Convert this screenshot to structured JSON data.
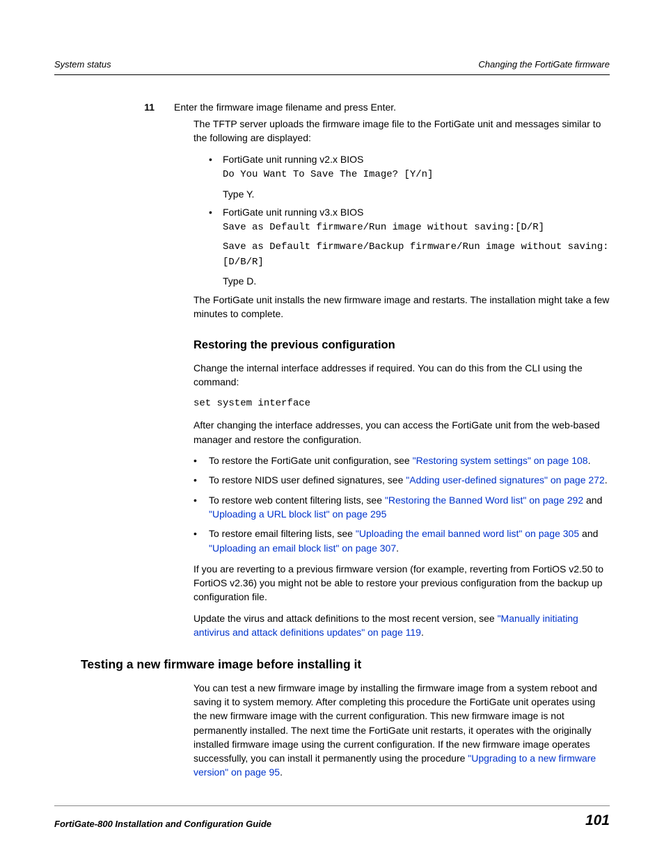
{
  "header": {
    "left": "System status",
    "right": "Changing the FortiGate firmware"
  },
  "step": {
    "num": "11",
    "intro": "Enter the firmware image filename and press Enter.",
    "tftp": "The TFTP server uploads the firmware image file to the FortiGate unit and messages similar to the following are displayed:",
    "b1": "FortiGate unit running v2.x BIOS",
    "code1": "Do You Want To Save The Image? [Y/n]",
    "type1": "Type Y.",
    "b2": "FortiGate unit running v3.x BIOS",
    "code2a": "Save as Default firmware/Run image without saving:[D/R]",
    "code2b": "Save as Default firmware/Backup firmware/Run image without saving:[D/B/R]",
    "type2": "Type D.",
    "install": "The FortiGate unit installs the new firmware image and restarts. The installation might take a few minutes to complete."
  },
  "restore": {
    "heading": "Restoring the previous configuration",
    "p1": "Change the internal interface addresses if required. You can do this from the CLI using the command:",
    "cmd": "set system interface",
    "p2": "After changing the interface addresses, you can access the FortiGate unit from the web-based manager and restore the configuration.",
    "li1a": "To restore the FortiGate unit configuration, see ",
    "li1link": "\"Restoring system settings\" on page 108",
    "li2a": "To restore NIDS user defined signatures, see ",
    "li2link": "\"Adding user-defined signatures\" on page 272",
    "li3a": "To restore web content filtering lists, see ",
    "li3linkA": "\"Restoring the Banned Word list\" on page 292",
    "li3mid": " and ",
    "li3linkB": "\"Uploading a URL block list\" on page 295",
    "li4a": "To restore email filtering lists, see ",
    "li4linkA": "\"Uploading the email banned word list\" on page 305",
    "li4mid": " and ",
    "li4linkB": "\"Uploading an email block list\" on page 307",
    "p3": "If you are reverting to a previous firmware version (for example, reverting from FortiOS v2.50 to FortiOS v2.36) you might not be able to restore your previous configuration from the backup up configuration file.",
    "p4a": "Update the virus and attack definitions to the most recent version, see ",
    "p4link": "\"Manually initiating antivirus and attack definitions updates\" on page 119"
  },
  "testing": {
    "heading": "Testing a new firmware image before installing it",
    "p1a": "You can test a new firmware image by installing the firmware image from a system reboot and saving it to system memory. After completing this procedure the FortiGate unit operates using the new firmware image with the current configuration. This new firmware image is not permanently installed. The next time the FortiGate unit restarts, it operates with the originally installed firmware image using the current configuration. If the new firmware image operates successfully, you can install it permanently using the procedure ",
    "p1link": "\"Upgrading to a new firmware version\" on page 95"
  },
  "footer": {
    "left": "FortiGate-800 Installation and Configuration Guide",
    "right": "101"
  }
}
